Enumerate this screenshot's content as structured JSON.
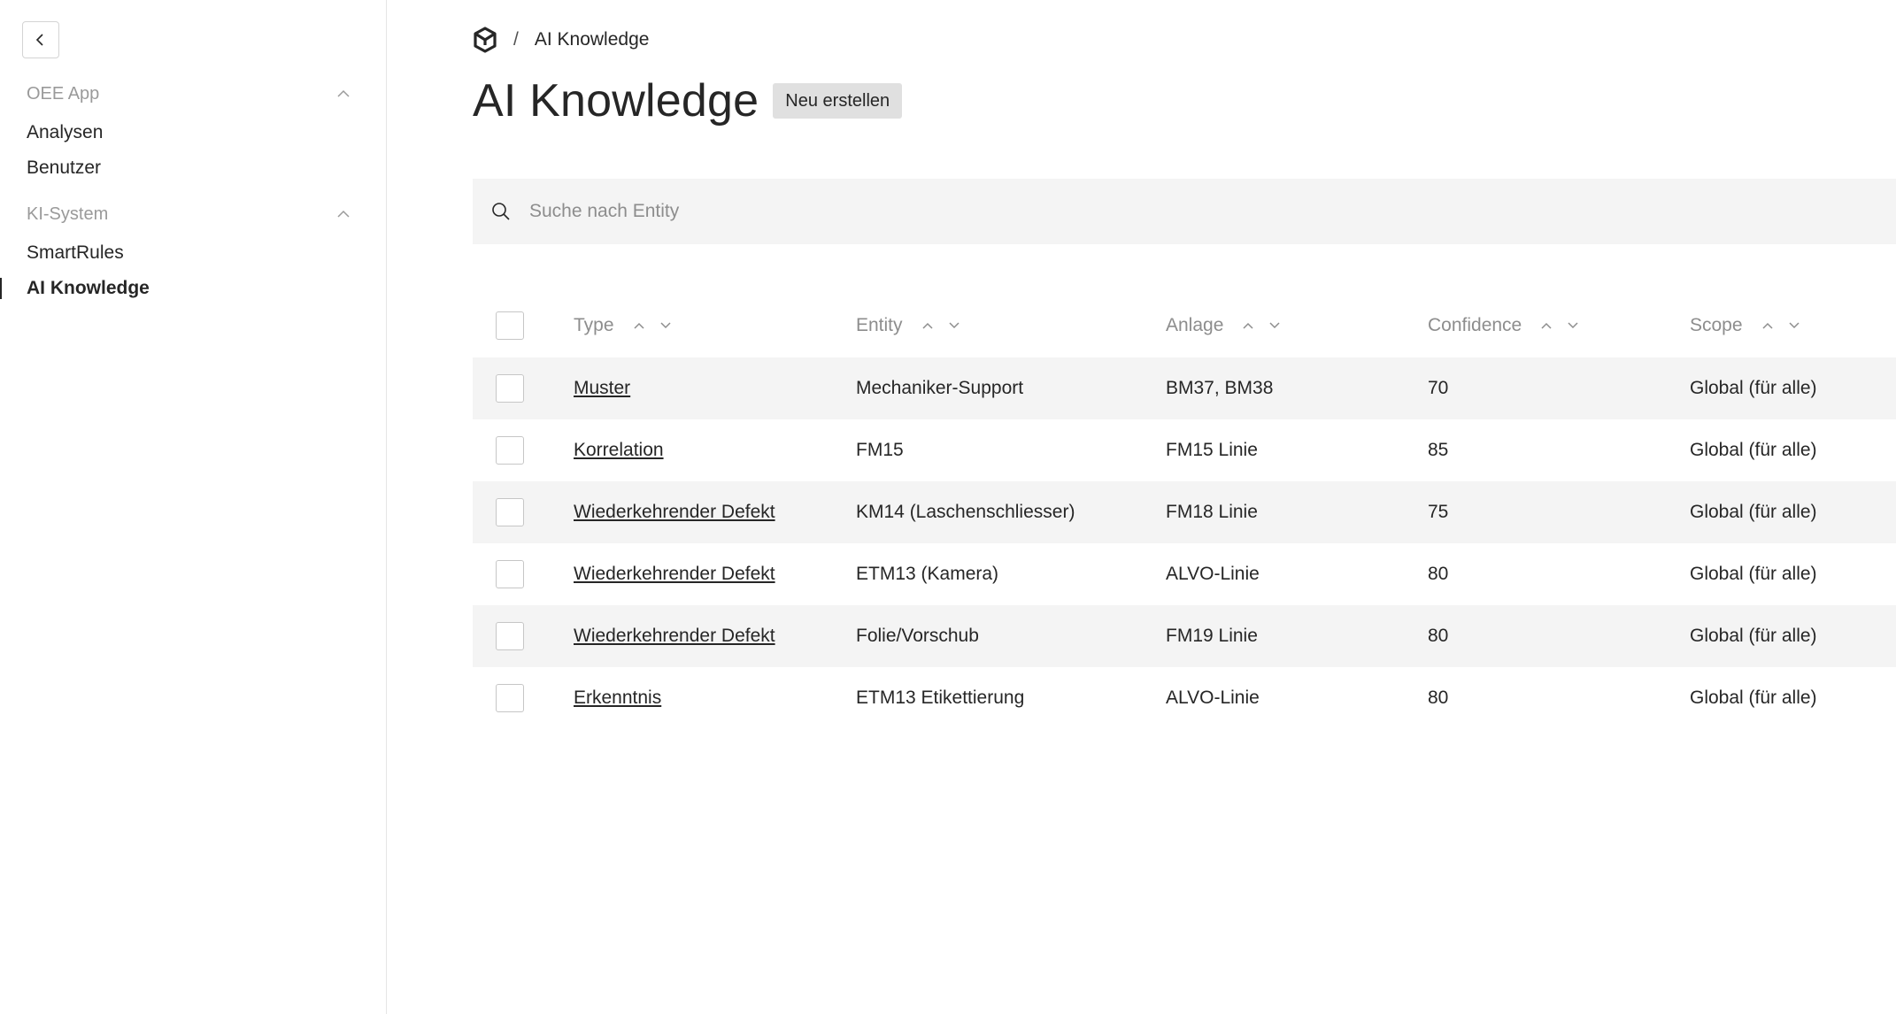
{
  "sidebar": {
    "sections": [
      {
        "title": "OEE App",
        "items": [
          "Analysen",
          "Benutzer"
        ]
      },
      {
        "title": "KI-System",
        "items": [
          "SmartRules",
          "AI Knowledge"
        ]
      }
    ],
    "active_item": "AI Knowledge"
  },
  "breadcrumb": {
    "separator": "/",
    "current": "AI Knowledge"
  },
  "page": {
    "title": "AI Knowledge",
    "create_label": "Neu erstellen"
  },
  "search": {
    "placeholder": "Suche nach Entity",
    "value": ""
  },
  "table": {
    "columns": [
      "Type",
      "Entity",
      "Anlage",
      "Confidence",
      "Scope"
    ],
    "rows": [
      {
        "type": "Muster",
        "entity": "Mechaniker-Support",
        "anlage": "BM37, BM38",
        "confidence": "70",
        "scope": "Global (für alle)"
      },
      {
        "type": "Korrelation",
        "entity": "FM15",
        "anlage": "FM15 Linie",
        "confidence": "85",
        "scope": "Global (für alle)"
      },
      {
        "type": "Wiederkehrender Defekt",
        "entity": "KM14 (Laschenschliesser)",
        "anlage": "FM18 Linie",
        "confidence": "75",
        "scope": "Global (für alle)"
      },
      {
        "type": "Wiederkehrender Defekt",
        "entity": "ETM13 (Kamera)",
        "anlage": "ALVO-Linie",
        "confidence": "80",
        "scope": "Global (für alle)"
      },
      {
        "type": "Wiederkehrender Defekt",
        "entity": "Folie/Vorschub",
        "anlage": "FM19 Linie",
        "confidence": "80",
        "scope": "Global (für alle)"
      },
      {
        "type": "Erkenntnis",
        "entity": "ETM13 Etikettierung",
        "anlage": "ALVO-Linie",
        "confidence": "80",
        "scope": "Global (für alle)"
      }
    ]
  },
  "icons": {
    "collapse": "chevron-left-icon",
    "section_toggle": "chevron-up-icon",
    "logo": "app-logo-icon",
    "search": "search-icon",
    "sort_asc": "sort-ascending-icon",
    "sort_desc": "sort-descending-icon"
  }
}
